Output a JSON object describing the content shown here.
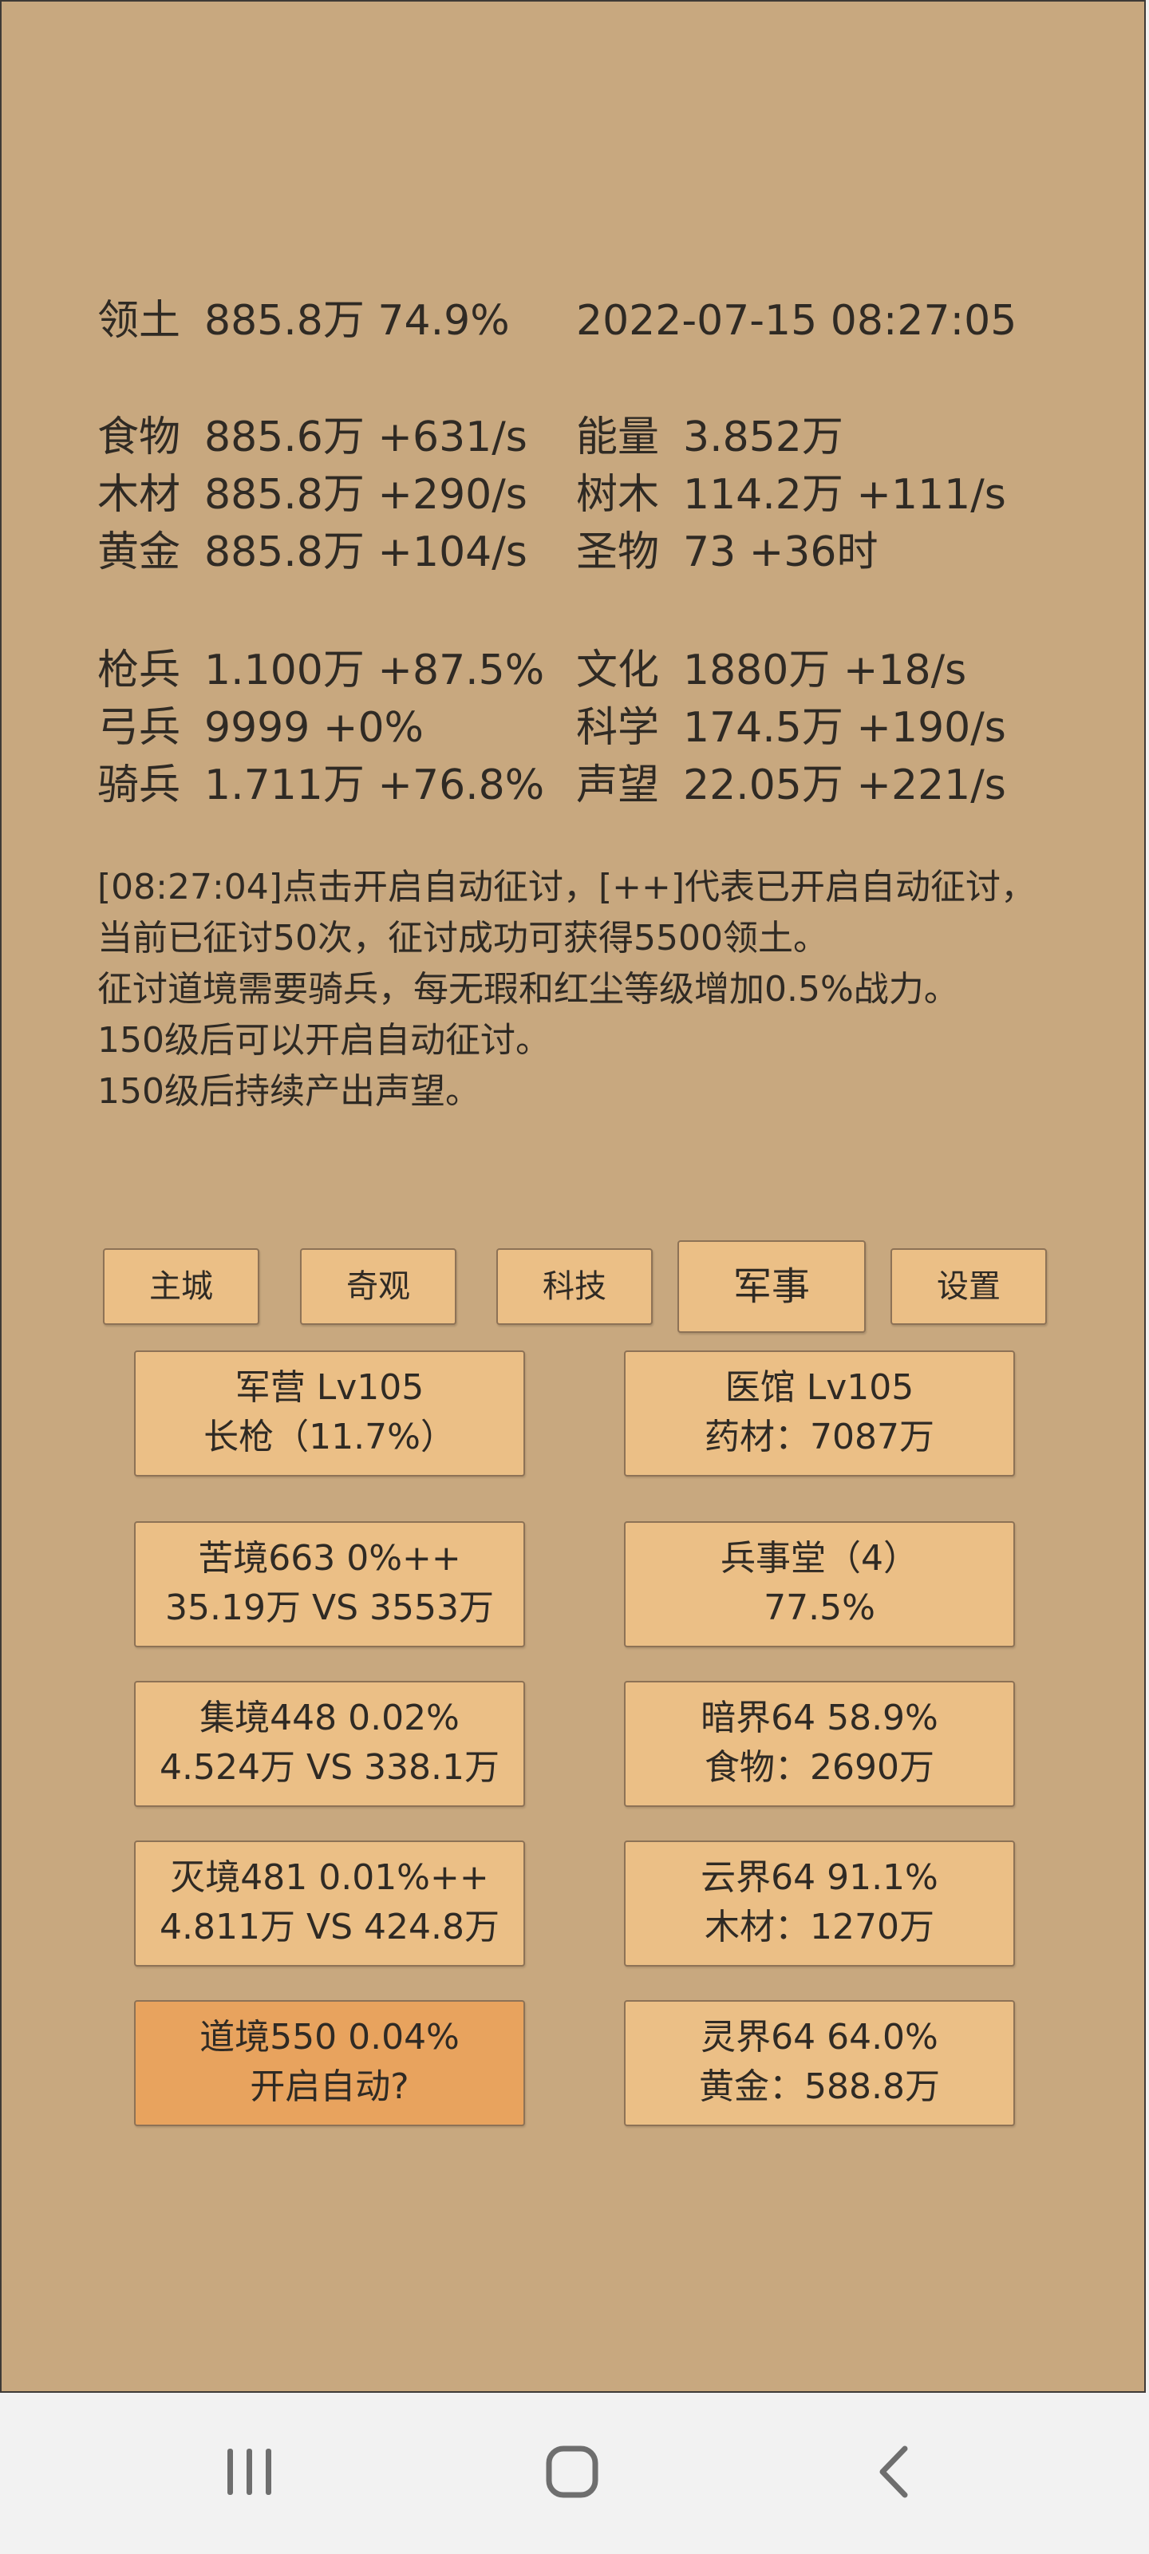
{
  "status": {
    "territory": {
      "label": "领土",
      "value": "885.8万  74.9%"
    },
    "datetime": "2022-07-15 08:27:05",
    "resources_left": [
      {
        "label": "食物",
        "value": "885.6万 +631/s"
      },
      {
        "label": "木材",
        "value": "885.8万 +290/s"
      },
      {
        "label": "黄金",
        "value": "885.8万 +104/s"
      }
    ],
    "resources_right": [
      {
        "label": "能量",
        "value": "3.852万"
      },
      {
        "label": "树木",
        "value": "114.2万 +111/s"
      },
      {
        "label": "圣物",
        "value": "73 +36时"
      }
    ],
    "troops_left": [
      {
        "label": "枪兵",
        "value": "1.100万 +87.5%"
      },
      {
        "label": "弓兵",
        "value": "9999 +0%"
      },
      {
        "label": "骑兵",
        "value": "1.711万 +76.8%"
      }
    ],
    "stats_right": [
      {
        "label": "文化",
        "value": "1880万 +18/s"
      },
      {
        "label": "科学",
        "value": "174.5万 +190/s"
      },
      {
        "label": "声望",
        "value": "22.05万 +221/s"
      }
    ]
  },
  "message": {
    "lines": [
      "[08:27:04]点击开启自动征讨，[++]代表已开启自动征讨，",
      "当前已征讨50次，征讨成功可获得5500领土。",
      "征讨道境需要骑兵，每无瑕和红尘等级增加0.5%战力。",
      "150级后可以开启自动征讨。",
      "150级后持续产出声望。"
    ]
  },
  "tabs": [
    {
      "label": "主城",
      "active": false
    },
    {
      "label": "奇观",
      "active": false
    },
    {
      "label": "科技",
      "active": false
    },
    {
      "label": "军事",
      "active": true
    },
    {
      "label": "设置",
      "active": false
    }
  ],
  "cards_left": [
    {
      "line1": "军营 Lv105",
      "line2": "长枪（11.7%）"
    },
    {
      "line1": "苦境663  0%++",
      "line2": "35.19万 VS 3553万"
    },
    {
      "line1": "集境448  0.02%",
      "line2": "4.524万 VS 338.1万"
    },
    {
      "line1": "灭境481  0.01%++",
      "line2": "4.811万 VS 424.8万"
    },
    {
      "line1": "道境550  0.04%",
      "line2": "开启自动?"
    }
  ],
  "cards_right": [
    {
      "line1": "医馆 Lv105",
      "line2": "药材：7087万"
    },
    {
      "line1": "兵事堂（4）",
      "line2": "77.5%"
    },
    {
      "line1": "暗界64  58.9%",
      "line2": "食物：2690万"
    },
    {
      "line1": "云界64  91.1%",
      "line2": "木材：1270万"
    },
    {
      "line1": "灵界64  64.0%",
      "line2": "黄金：588.8万"
    }
  ],
  "navbar": {
    "icons": [
      "recent-apps-icon",
      "home-icon",
      "back-icon"
    ]
  },
  "colors": {
    "background": "#c8a87f",
    "button": "#ebbf86",
    "highlight_button": "#e8a35e",
    "text": "#2f2a24"
  }
}
